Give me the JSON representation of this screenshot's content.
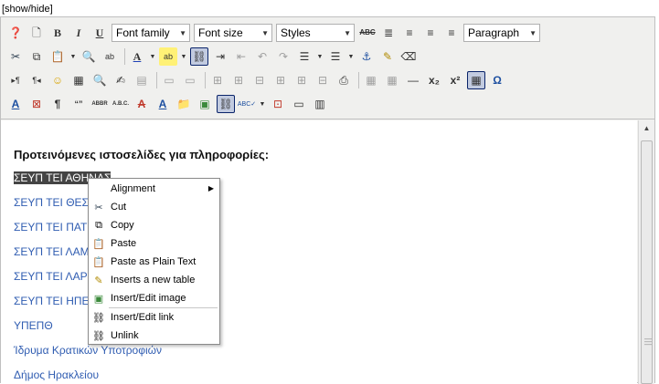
{
  "show_hide": "[show/hide]",
  "toolbar": {
    "font_family": "Font family",
    "font_size": "Font size",
    "styles": "Styles",
    "paragraph": "Paragraph",
    "strike_label": "ABC",
    "abbr_label": "ABBR",
    "acronym_label": "A.B.C.",
    "quote_label": "“”"
  },
  "content": {
    "heading": "Προτεινόμενες ιστοσελίδες για πληροφορίες:",
    "links": [
      "ΣΕΥΠ ΤΕΙ ΑΘΗΝΑΣ",
      "ΣΕΥΠ ΤΕΙ ΘΕΣ",
      "ΣΕΥΠ ΤΕΙ ΠΑΤ",
      "ΣΕΥΠ ΤΕΙ ΛΑΜ",
      "ΣΕΥΠ ΤΕΙ ΛΑΡ",
      "ΣΕΥΠ ΤΕΙ ΗΠΕ",
      "ΥΠΕΠΘ",
      "Ίδρυμα Κρατικών Υποτροφιών",
      "Δήμος Ηρακλείου"
    ]
  },
  "context_menu": {
    "alignment": "Alignment",
    "cut": "Cut",
    "copy": "Copy",
    "paste": "Paste",
    "paste_plain": "Paste as Plain Text",
    "insert_table": "Inserts a new table",
    "insert_image": "Insert/Edit image",
    "insert_link": "Insert/Edit link",
    "unlink": "Unlink"
  },
  "colors": {
    "link": "#2f5cb1",
    "selection": "#444444",
    "toolbar_bg": "#f0f0ee",
    "active_button": "#c2cbe0"
  }
}
